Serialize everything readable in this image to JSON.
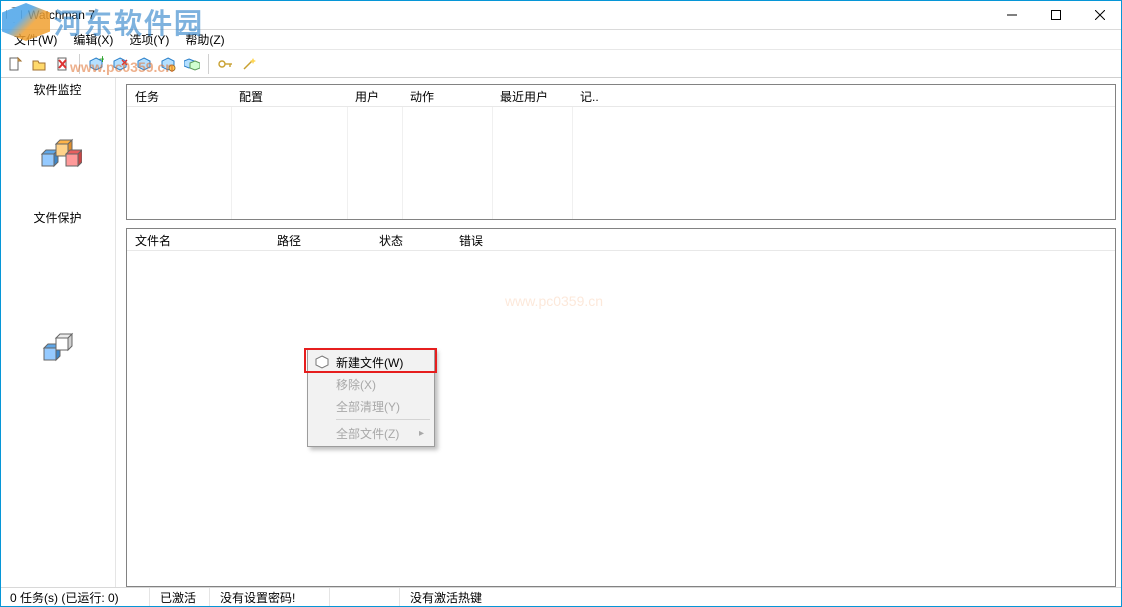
{
  "window": {
    "title": "Watchman 7"
  },
  "menu": {
    "file": "文件(W)",
    "edit": "编辑(X)",
    "options": "选项(Y)",
    "help": "帮助(Z)"
  },
  "sidebar": {
    "monitor": "软件监控",
    "protect": "文件保护"
  },
  "panel_top": {
    "headers": [
      "任务",
      "配置",
      "用户",
      "动作",
      "最近用户",
      "记.."
    ]
  },
  "panel_bottom": {
    "headers": [
      "文件名",
      "路径",
      "状态",
      "错误"
    ]
  },
  "context_menu": {
    "new_file": "新建文件(W)",
    "remove": "移除(X)",
    "clear_all": "全部清理(Y)",
    "all_files": "全部文件(Z)"
  },
  "status": {
    "tasks": "0 任务(s) (已运行: 0)",
    "activated": "已激活",
    "no_password": "没有设置密码!",
    "empty": "",
    "no_hotkey": "没有激活热键"
  },
  "watermark": {
    "text": "河东软件园",
    "url": "www.pc0359.cn",
    "center": "www.pc0359.cn"
  },
  "icons": {
    "minimize": "minimize-icon",
    "maximize": "maximize-icon",
    "close": "close-icon"
  }
}
